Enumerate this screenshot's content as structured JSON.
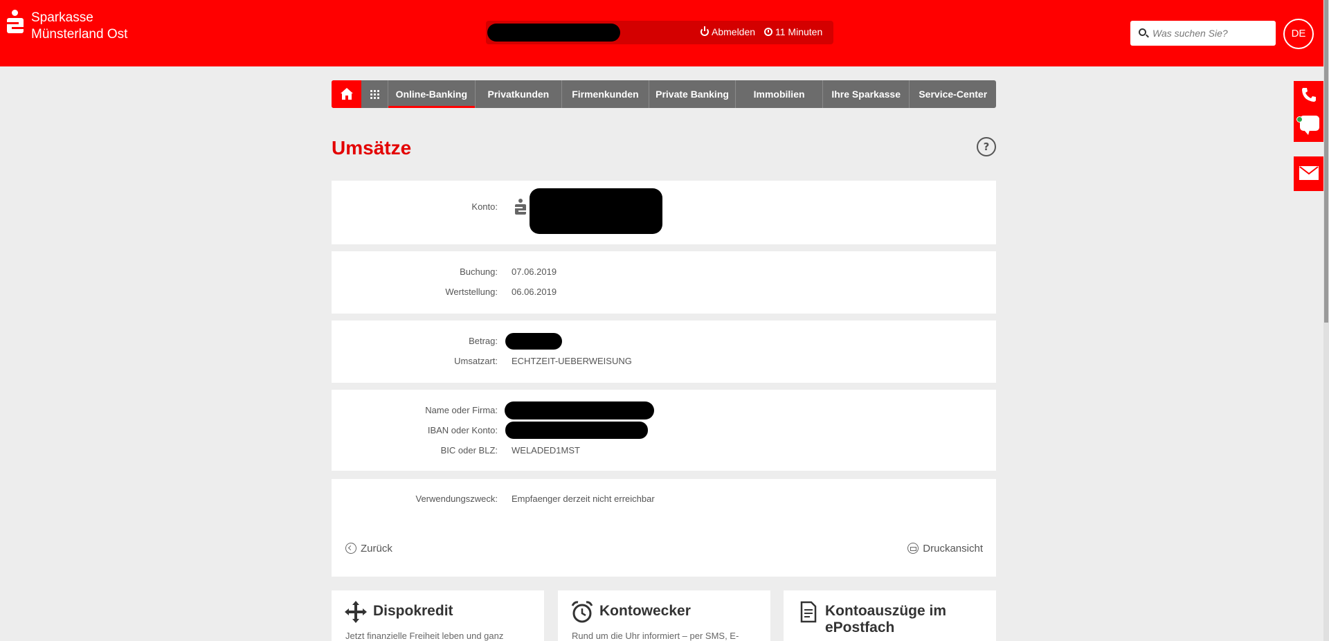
{
  "header": {
    "brand_line1": "Sparkasse",
    "brand_line2": "Münsterland Ost",
    "logout_label": "Abmelden",
    "session_timer": "11 Minuten",
    "search_placeholder": "Was suchen Sie?",
    "language": "DE"
  },
  "nav": {
    "items": [
      {
        "label": "Online-Banking",
        "active": true
      },
      {
        "label": "Privatkunden"
      },
      {
        "label": "Firmenkunden"
      },
      {
        "label": "Private Banking"
      },
      {
        "label": "Immobilien"
      },
      {
        "label": "Ihre Sparkasse"
      },
      {
        "label": "Service-Center"
      }
    ]
  },
  "page": {
    "title": "Umsätze",
    "help_label": "?"
  },
  "details": {
    "konto_label": "Konto:",
    "buchung_label": "Buchung:",
    "buchung_value": "07.06.2019",
    "wertstellung_label": "Wertstellung:",
    "wertstellung_value": "06.06.2019",
    "betrag_label": "Betrag:",
    "umsatzart_label": "Umsatzart:",
    "umsatzart_value": "ECHTZEIT-UEBERWEISUNG",
    "name_label": "Name oder Firma:",
    "iban_label": "IBAN oder Konto:",
    "bic_label": "BIC oder BLZ:",
    "bic_value": "WELADED1MST",
    "verwendungszweck_label": "Verwendungszweck:",
    "verwendungszweck_value": "Empfaenger derzeit nicht erreichbar"
  },
  "actions": {
    "back_label": "Zurück",
    "print_label": "Druckansicht"
  },
  "teasers": [
    {
      "title": "Dispokredit",
      "text": "Jetzt finanzielle Freiheit leben und ganz",
      "icon": "move-arrows-icon"
    },
    {
      "title": "Kontowecker",
      "text": "Rund um die Uhr informiert – per SMS, E-",
      "icon": "alarm-clock-icon"
    },
    {
      "title_line1": "Kontoauszüge im",
      "title_line2": "ePostfach",
      "icon": "document-icon"
    }
  ],
  "colors": {
    "brand_red": "#ff0000",
    "title_red": "#e30000",
    "nav_gray": "#6c6c6c",
    "background": "#ededed"
  }
}
